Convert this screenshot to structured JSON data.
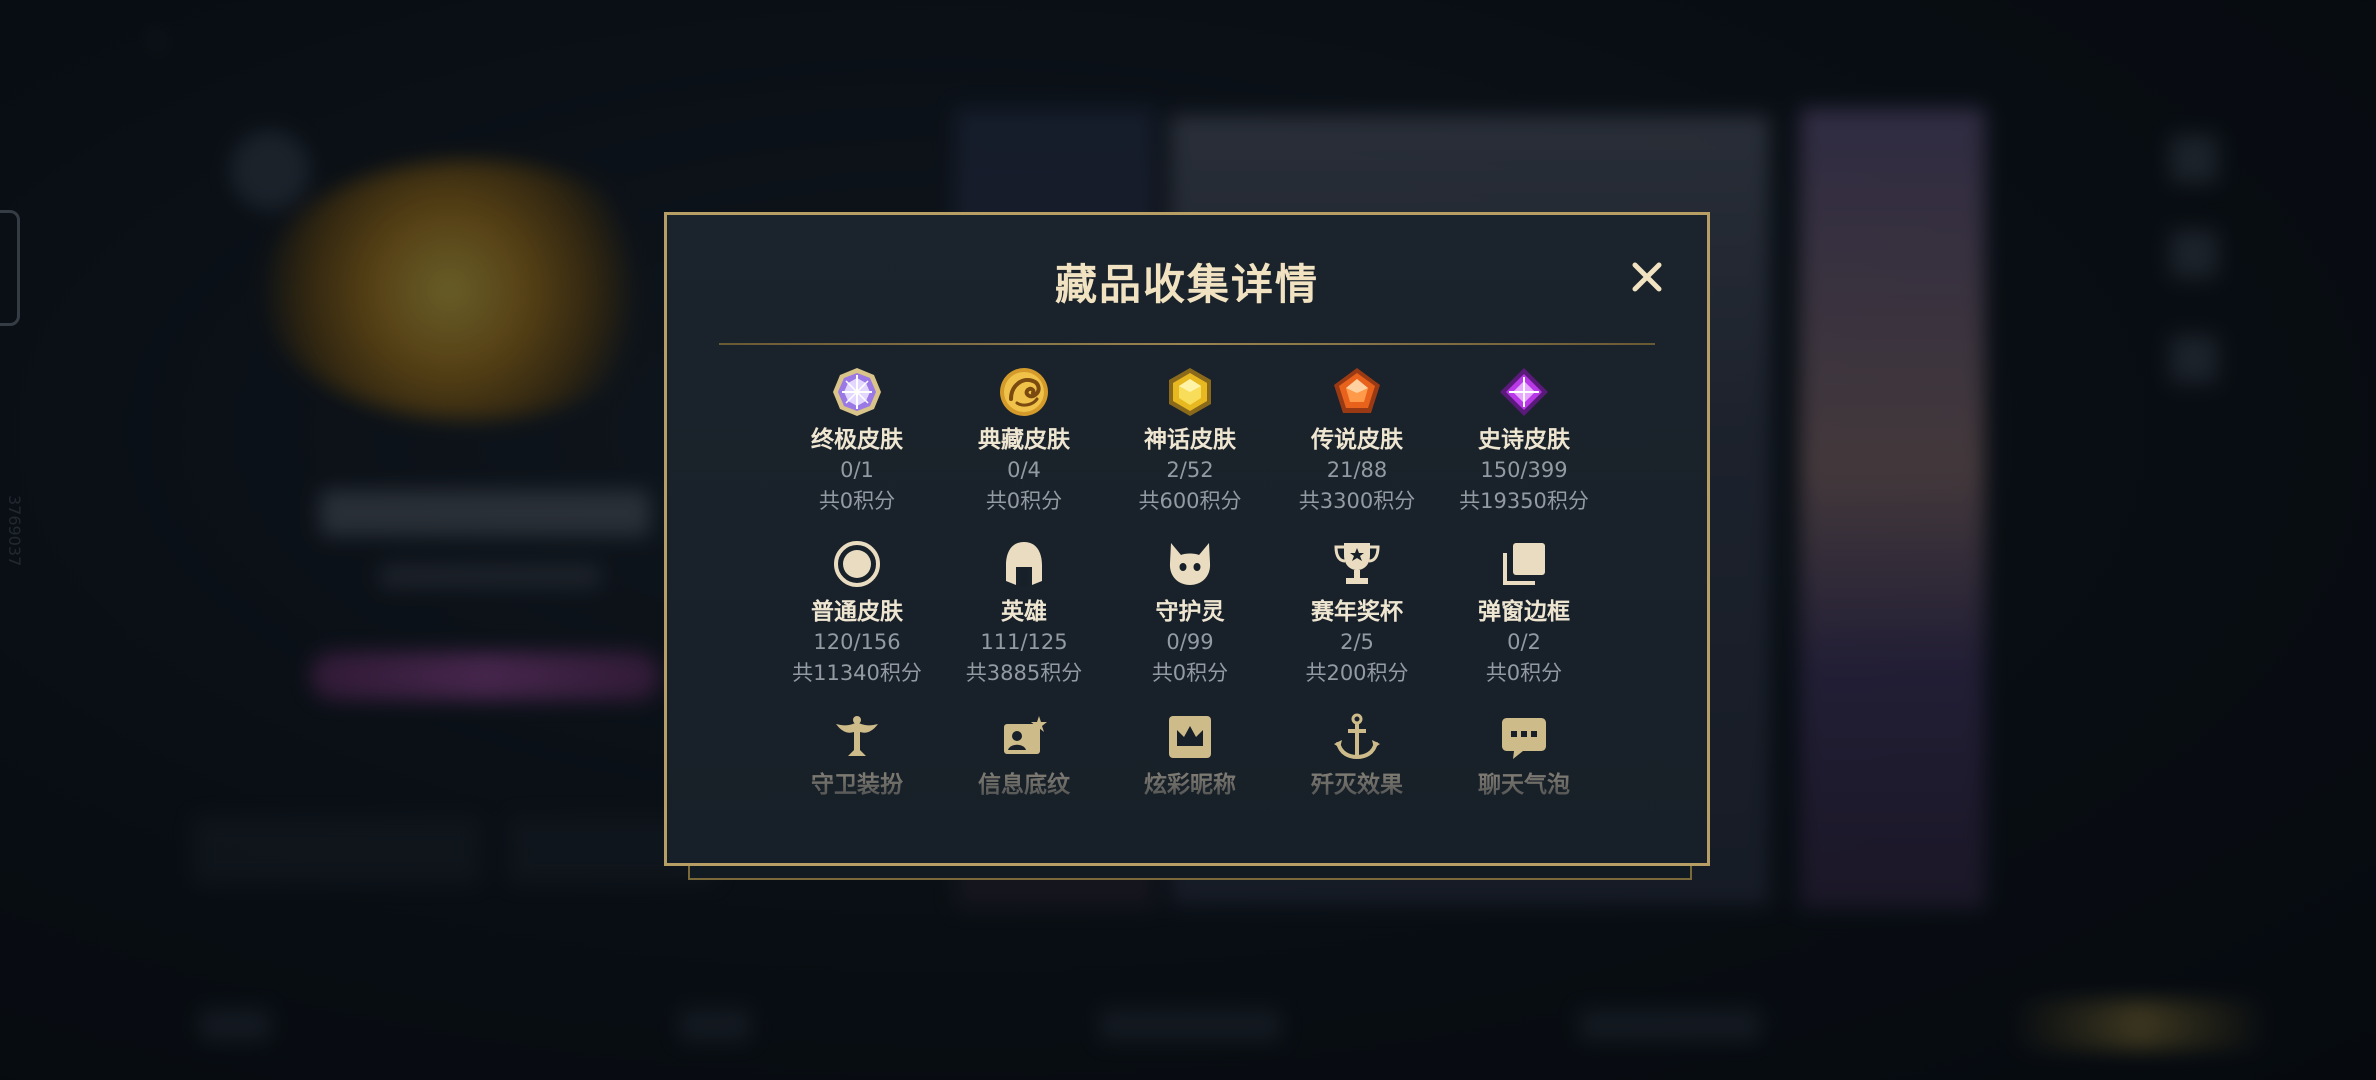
{
  "modal": {
    "title": "藏品收集详情"
  },
  "collection": {
    "row1": [
      {
        "label": "终极皮肤",
        "count": "0/1",
        "points": "共0积分"
      },
      {
        "label": "典藏皮肤",
        "count": "0/4",
        "points": "共0积分"
      },
      {
        "label": "神话皮肤",
        "count": "2/52",
        "points": "共600积分"
      },
      {
        "label": "传说皮肤",
        "count": "21/88",
        "points": "共3300积分"
      },
      {
        "label": "史诗皮肤",
        "count": "150/399",
        "points": "共19350积分"
      }
    ],
    "row2": [
      {
        "label": "普通皮肤",
        "count": "120/156",
        "points": "共11340积分"
      },
      {
        "label": "英雄",
        "count": "111/125",
        "points": "共3885积分"
      },
      {
        "label": "守护灵",
        "count": "0/99",
        "points": "共0积分"
      },
      {
        "label": "赛年奖杯",
        "count": "2/5",
        "points": "共200积分"
      },
      {
        "label": "弹窗边框",
        "count": "0/2",
        "points": "共0积分"
      }
    ],
    "row3": [
      {
        "label": "守卫装扮"
      },
      {
        "label": "信息底纹"
      },
      {
        "label": "炫彩昵称"
      },
      {
        "label": "歼灭效果"
      },
      {
        "label": "聊天气泡"
      }
    ]
  },
  "background": {
    "vertical_id": "3769037"
  },
  "colors": {
    "gold_border": "#b69e64",
    "title": "#f1e3c2",
    "label": "#efe6d2",
    "value": "#939aa2",
    "panel": "#1b232c"
  }
}
